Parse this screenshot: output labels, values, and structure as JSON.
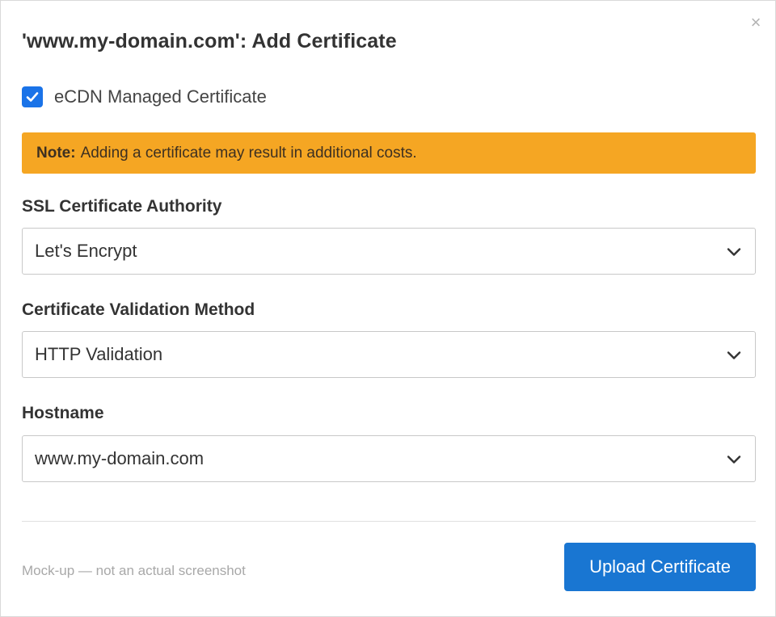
{
  "dialog": {
    "title": "'www.my-domain.com': Add Certificate",
    "close_symbol": "×",
    "close_icon": "close-icon"
  },
  "managed_checkbox": {
    "label": "eCDN Managed Certificate",
    "checked": true,
    "icon": "checkmark-icon"
  },
  "note": {
    "prefix": "Note:",
    "text": "Adding a certificate may result in additional costs.",
    "color": "#f5a623"
  },
  "fields": {
    "authority": {
      "label": "SSL Certificate Authority",
      "value": "Let's Encrypt",
      "icon": "chevron-down-icon"
    },
    "validation": {
      "label": "Certificate Validation Method",
      "value": "HTTP Validation",
      "icon": "chevron-down-icon"
    },
    "hostname": {
      "label": "Hostname",
      "value": "www.my-domain.com",
      "icon": "chevron-down-icon"
    }
  },
  "footer": {
    "footnote": "Mock-up — not an actual screenshot",
    "upload_label": "Upload Certificate",
    "accent_color": "#1976d2"
  }
}
